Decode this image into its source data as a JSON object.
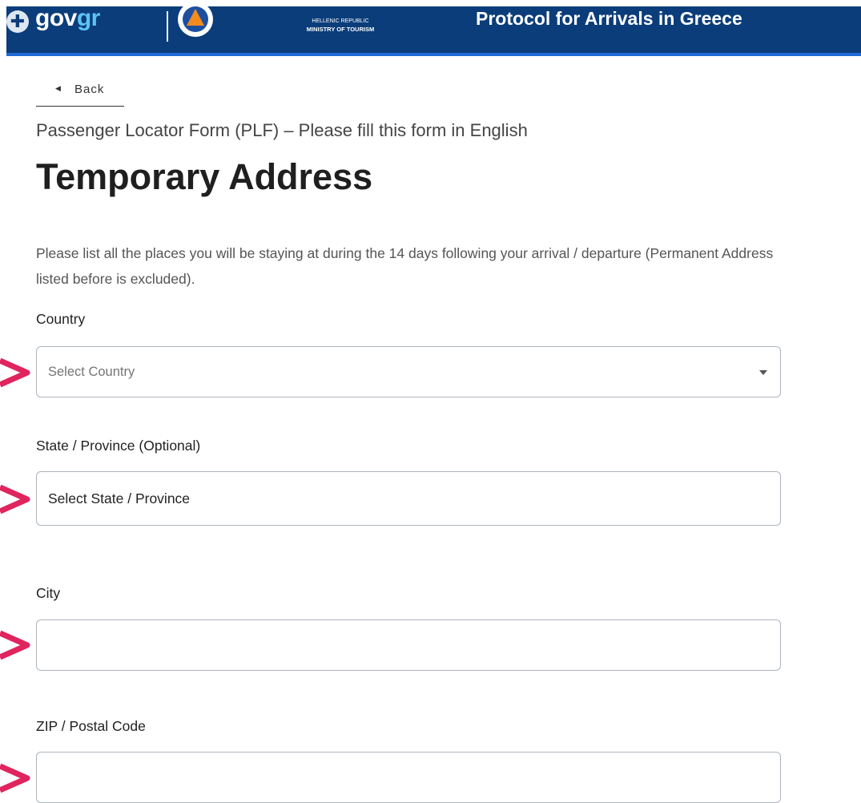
{
  "header": {
    "brand_gov": "gov",
    "brand_gr": "gr",
    "ministry_line1": "HELLENIC REPUBLIC",
    "ministry_line2": "MINISTRY OF TOURISM",
    "title": "Protocol for Arrivals in Greece"
  },
  "nav": {
    "back_label": "Back"
  },
  "page": {
    "subtitle": "Passenger Locator Form (PLF) – Please fill this form in English",
    "heading": "Temporary Address",
    "description": "Please list all the places you will be staying at during the 14 days following your arrival / departure (Permanent Address listed before is excluded)."
  },
  "form": {
    "country_label": "Country",
    "country_placeholder": "Select Country",
    "state_label": "State / Province (Optional)",
    "state_placeholder": "Select State / Province",
    "city_label": "City",
    "city_value": "",
    "zip_label": "ZIP / Postal Code",
    "zip_value": ""
  },
  "colors": {
    "header_bg": "#0b3d7a",
    "header_accent": "#1f6bd6",
    "arrow_red": "#e0245e"
  }
}
